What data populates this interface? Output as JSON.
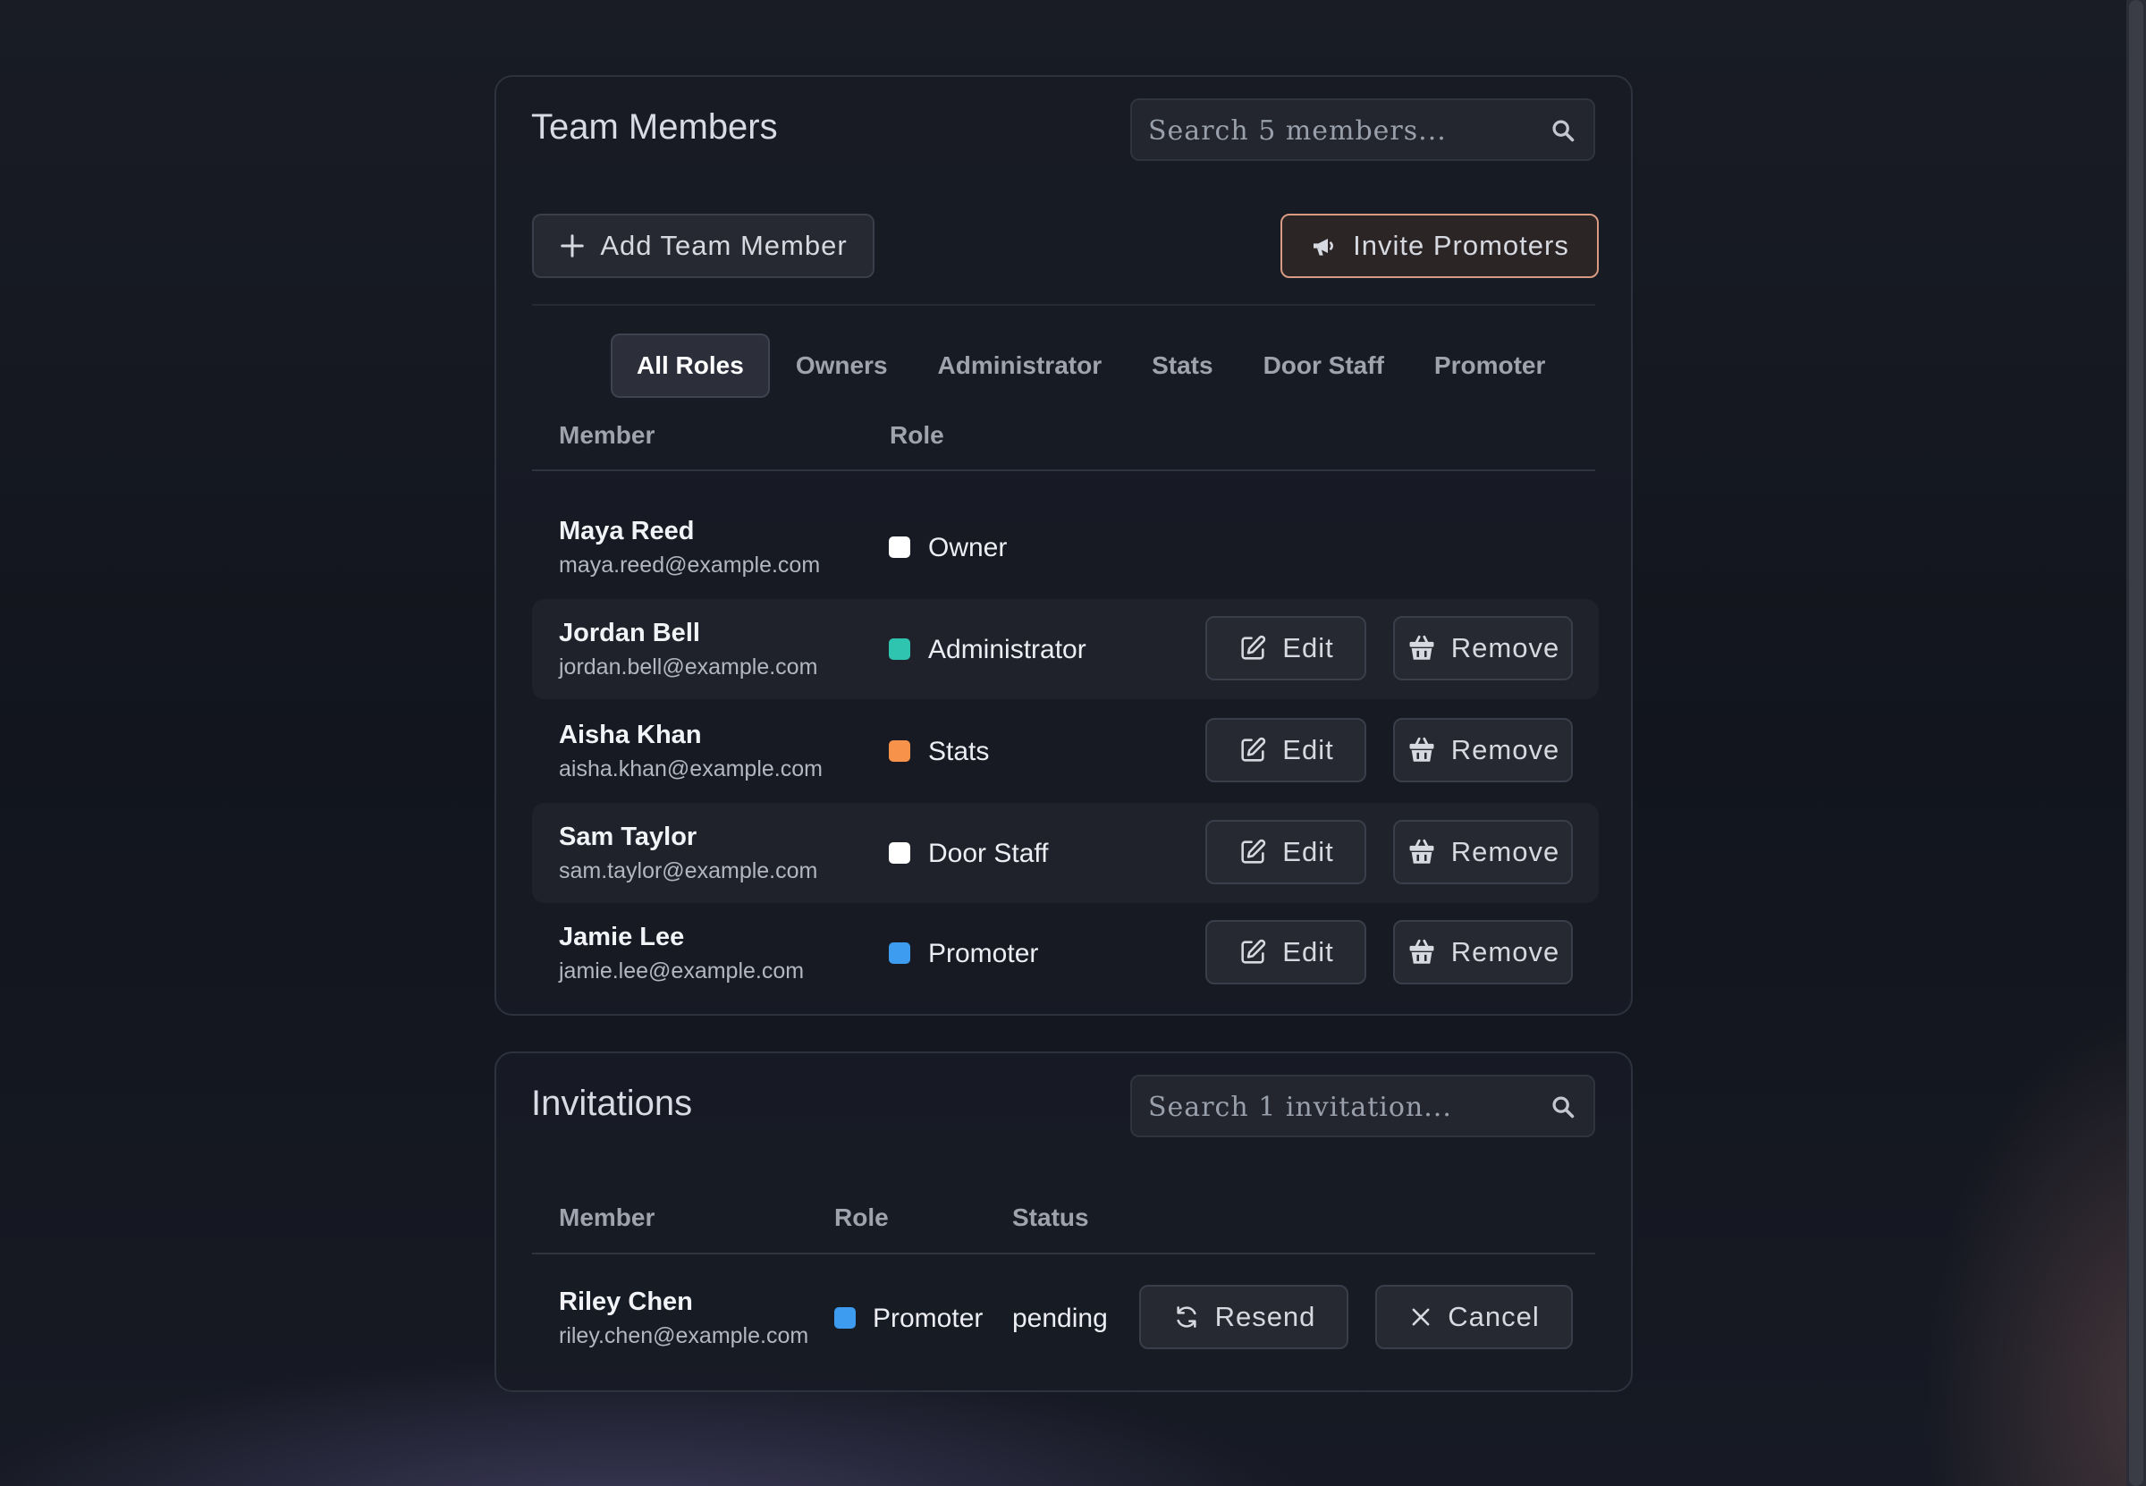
{
  "team": {
    "title": "Team Members",
    "search_placeholder": "Search 5 members...",
    "add_label": "Add Team Member",
    "invite_label": "Invite Promoters",
    "tabs": [
      "All Roles",
      "Owners",
      "Administrator",
      "Stats",
      "Door Staff",
      "Promoter"
    ],
    "active_tab": "All Roles",
    "col_member": "Member",
    "col_role": "Role",
    "edit_label": "Edit",
    "remove_label": "Remove",
    "members": [
      {
        "name": "Maya Reed",
        "email": "maya.reed@example.com",
        "role": "Owner",
        "role_color": "#ffffff"
      },
      {
        "name": "Jordan Bell",
        "email": "jordan.bell@example.com",
        "role": "Administrator",
        "role_color": "#2ec4b0"
      },
      {
        "name": "Aisha Khan",
        "email": "aisha.khan@example.com",
        "role": "Stats",
        "role_color": "#f7924a"
      },
      {
        "name": "Sam Taylor",
        "email": "sam.taylor@example.com",
        "role": "Door Staff",
        "role_color": "#ffffff"
      },
      {
        "name": "Jamie Lee",
        "email": "jamie.lee@example.com",
        "role": "Promoter",
        "role_color": "#3d9cf0"
      }
    ]
  },
  "invitations": {
    "title": "Invitations",
    "search_placeholder": "Search 1 invitation...",
    "col_member": "Member",
    "col_role": "Role",
    "col_status": "Status",
    "resend_label": "Resend",
    "cancel_label": "Cancel",
    "rows": [
      {
        "name": "Riley Chen",
        "email": "riley.chen@example.com",
        "role": "Promoter",
        "role_color": "#3d9cf0",
        "status": "pending"
      }
    ]
  },
  "icons": {
    "search": "search-icon",
    "add": "plus-icon",
    "invite": "megaphone-icon",
    "edit": "edit-icon",
    "remove": "basket-icon",
    "resend": "refresh-icon",
    "cancel": "close-icon"
  }
}
